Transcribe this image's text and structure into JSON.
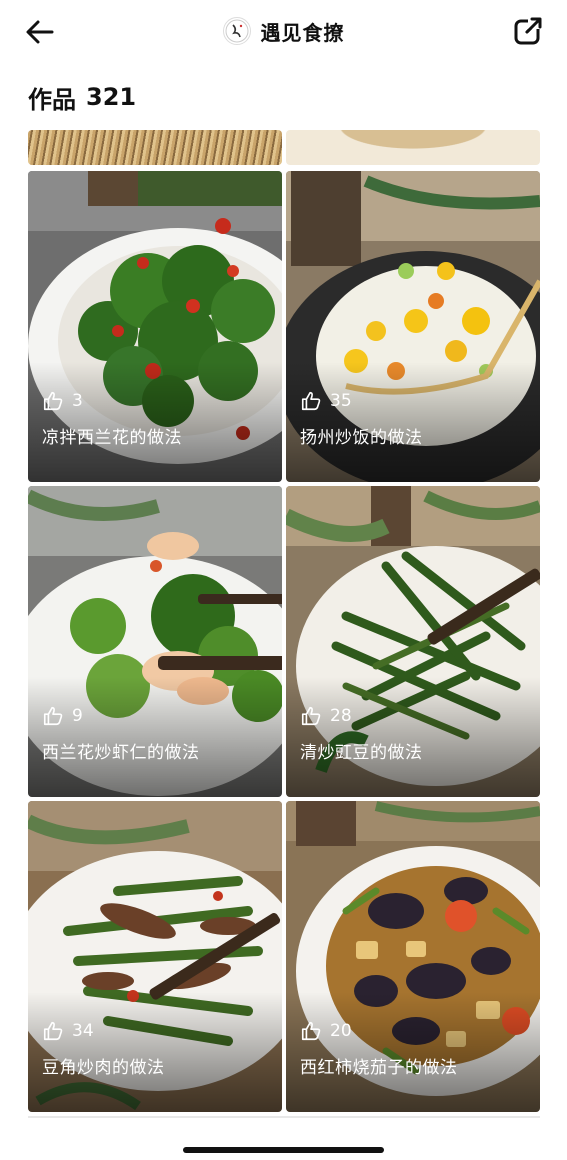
{
  "header": {
    "title": "遇见食撩",
    "back_icon": "arrow-left-icon",
    "share_icon": "share-icon"
  },
  "works": {
    "label": "作品",
    "count": "321"
  },
  "recipes": [
    {
      "likes": "3",
      "name": "凉拌西兰花的做法"
    },
    {
      "likes": "35",
      "name": "扬州炒饭的做法"
    },
    {
      "likes": "9",
      "name": "西兰花炒虾仁的做法"
    },
    {
      "likes": "28",
      "name": "清炒豇豆的做法"
    },
    {
      "likes": "34",
      "name": "豆角炒肉的做法"
    },
    {
      "likes": "20",
      "name": "西红柿烧茄子的做法"
    }
  ],
  "colors": {
    "text": "#111111",
    "overlay_text": "#ffffff",
    "background": "#ffffff"
  }
}
